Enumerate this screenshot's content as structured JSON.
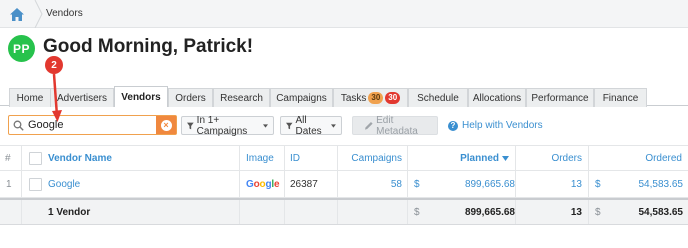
{
  "breadcrumb": {
    "current": "Vendors"
  },
  "header": {
    "avatar_initials": "PP",
    "greeting": "Good Morning, Patrick!"
  },
  "annotation": {
    "step": "2"
  },
  "tabs": [
    {
      "label": "Home"
    },
    {
      "label": "Advertisers"
    },
    {
      "label": "Vendors",
      "active": true
    },
    {
      "label": "Orders"
    },
    {
      "label": "Research"
    },
    {
      "label": "Campaigns"
    },
    {
      "label": "Tasks",
      "badges": [
        "30",
        "30"
      ]
    },
    {
      "label": "Schedule"
    },
    {
      "label": "Allocations"
    },
    {
      "label": "Performance"
    },
    {
      "label": "Finance"
    }
  ],
  "toolbar": {
    "search_value": "Google",
    "filter_campaigns": "In 1+ Campaigns",
    "filter_dates": "All Dates",
    "edit_metadata": "Edit Metadata",
    "help": "Help with Vendors"
  },
  "table": {
    "columns": {
      "index": "#",
      "vendor_name": "Vendor Name",
      "image": "Image",
      "id": "ID",
      "campaigns": "Campaigns",
      "planned": "Planned",
      "orders": "Orders",
      "ordered": "Ordered"
    },
    "rows": [
      {
        "index": "1",
        "vendor_name": "Google",
        "image_text": "Google",
        "id": "26387",
        "campaigns": "58",
        "planned_currency": "$",
        "planned": "899,665.68",
        "orders": "13",
        "ordered_currency": "$",
        "ordered": "54,583.65"
      }
    ],
    "total": {
      "label": "1 Vendor",
      "planned_currency": "$",
      "planned": "899,665.68",
      "orders": "13",
      "ordered_currency": "$",
      "ordered": "54,583.65"
    }
  },
  "colors": {
    "accent": "#3a8fd0",
    "avatar": "#27c24c",
    "badge_orange": "#f0a14e",
    "badge_red": "#e2382f",
    "search_border": "#f0a14e"
  }
}
